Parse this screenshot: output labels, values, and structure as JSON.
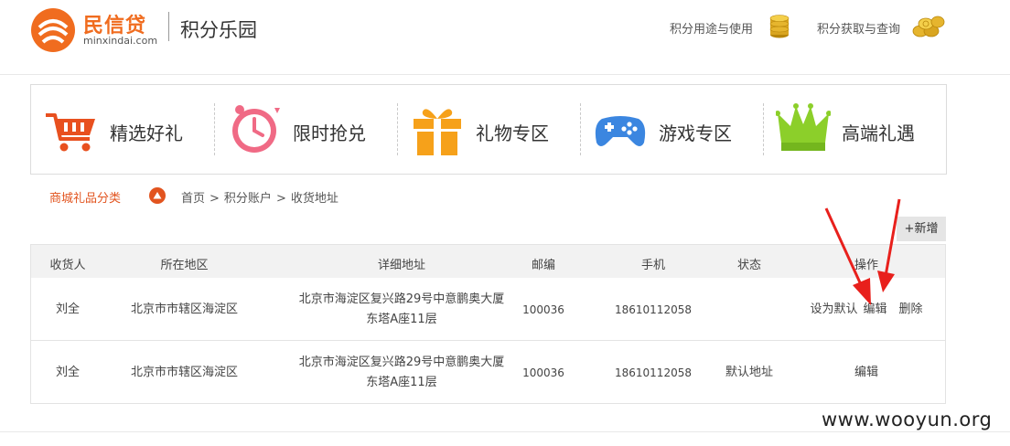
{
  "header": {
    "brand_cn": "民信贷",
    "brand_en": "minxindai.com",
    "site_title": "积分乐园",
    "links": [
      {
        "label": "积分用途与使用",
        "icon": "coin-stack-icon"
      },
      {
        "label": "积分获取与查询",
        "icon": "coin-pile-icon"
      }
    ]
  },
  "categories": [
    {
      "label": "精选好礼",
      "icon": "shopping-cart-icon"
    },
    {
      "label": "限时抢兑",
      "icon": "alarm-clock-icon"
    },
    {
      "label": "礼物专区",
      "icon": "gift-box-icon"
    },
    {
      "label": "游戏专区",
      "icon": "gamepad-icon"
    },
    {
      "label": "高端礼遇",
      "icon": "crown-icon"
    }
  ],
  "breadcrumb": {
    "mall_category": "商城礼品分类",
    "items": [
      "首页",
      "积分账户",
      "收货地址"
    ],
    "separator": ">"
  },
  "add_button": "+新增",
  "table": {
    "headers": [
      "收货人",
      "所在地区",
      "详细地址",
      "邮编",
      "手机",
      "状态",
      "操作"
    ],
    "rows": [
      {
        "name": "刘全",
        "region": "北京市市辖区海淀区",
        "address_line1": "北京市海淀区复兴路29号中意鹏奥大厦",
        "address_line2": "东塔A座11层",
        "zip": "100036",
        "phone": "18610112058",
        "status": "",
        "ops": [
          "设为默认",
          "编辑",
          "删除"
        ]
      },
      {
        "name": "刘全",
        "region": "北京市市辖区海淀区",
        "address_line1": "北京市海淀区复兴路29号中意鹏奥大厦",
        "address_line2": "东塔A座11层",
        "zip": "100036",
        "phone": "18610112058",
        "status": "默认地址",
        "ops": [
          "编辑"
        ]
      }
    ]
  },
  "watermark": "www.wooyun.org",
  "colors": {
    "brand_orange": "#f06c1f",
    "accent_red": "#e2541f",
    "annotation_red": "#e8201c",
    "header_bg": "#f2f2f2"
  }
}
